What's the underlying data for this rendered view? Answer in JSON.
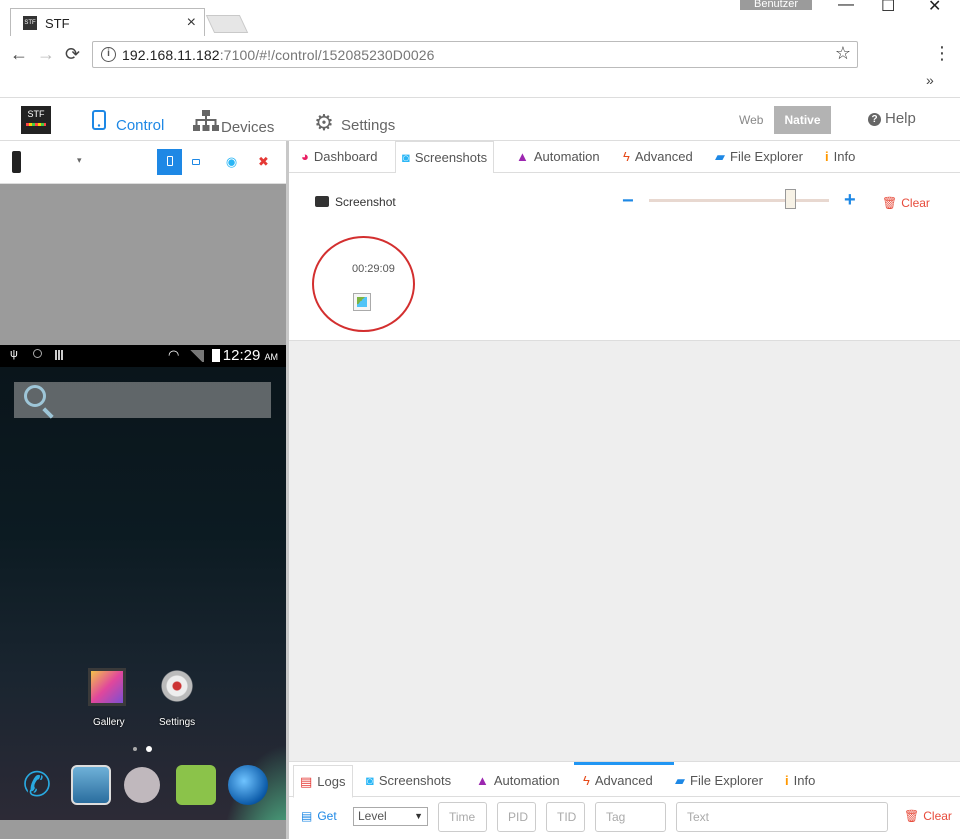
{
  "browser": {
    "tab_title": "STF",
    "tab_close": "×",
    "user_label": "Benutzer",
    "window_minimize": "—",
    "window_restore": "☐",
    "window_close": "✕",
    "nav_back": "←",
    "nav_forward": "→",
    "nav_reload": "⟳",
    "url_host": "192.168.11.182",
    "url_path": ":7100/#!/control/152085230D0026",
    "info_icon": "i",
    "bookmark_star": "☆",
    "menu_dots": "⋮",
    "overflow": "»"
  },
  "stf_nav": {
    "logo": "STF",
    "items": [
      {
        "label": "Control",
        "icon": "phone-icon"
      },
      {
        "label": "Devices",
        "icon": "sitemap-icon"
      },
      {
        "label": "Settings",
        "icon": "gears-icon"
      }
    ],
    "web_label": "Web",
    "native_label": "Native",
    "help_label": "Help"
  },
  "device_bar": {
    "caret": "▾",
    "buttons": [
      "portrait-icon",
      "landscape-icon",
      "eye-icon",
      "close-icon"
    ]
  },
  "phone": {
    "time": "12:29",
    "ampm": "AM",
    "apps": [
      {
        "label": "Gallery"
      },
      {
        "label": "Settings"
      }
    ]
  },
  "top_tabs": [
    {
      "label": "Dashboard",
      "icon": "dashboard-icon",
      "color": "#e91e63"
    },
    {
      "label": "Screenshots",
      "icon": "camera-icon",
      "color": "#29b6f6"
    },
    {
      "label": "Automation",
      "icon": "road-icon",
      "color": "#9c27b0"
    },
    {
      "label": "Advanced",
      "icon": "bolt-icon",
      "color": "#e64a19"
    },
    {
      "label": "File Explorer",
      "icon": "folder-open-icon",
      "color": "#1e88e5"
    },
    {
      "label": "Info",
      "icon": "info-icon",
      "color": "#ff9800"
    }
  ],
  "screenshots": {
    "button_label": "Screenshot",
    "minus": "−",
    "plus": "+",
    "clear_label": "Clear",
    "zoom_fraction": 0.82,
    "items": [
      {
        "time": "00:29:09"
      }
    ]
  },
  "bottom_tabs": [
    {
      "label": "Logs",
      "icon": "list-icon",
      "color": "#e53935"
    },
    {
      "label": "Screenshots",
      "icon": "camera-icon",
      "color": "#29b6f6"
    },
    {
      "label": "Automation",
      "icon": "road-icon",
      "color": "#9c27b0"
    },
    {
      "label": "Advanced",
      "icon": "bolt-icon",
      "color": "#e64a19"
    },
    {
      "label": "File Explorer",
      "icon": "folder-open-icon",
      "color": "#1e88e5"
    },
    {
      "label": "Info",
      "icon": "info-icon",
      "color": "#ff9800"
    }
  ],
  "logs": {
    "get_label": "Get",
    "level_label": "Level",
    "fields": [
      {
        "placeholder": "Time"
      },
      {
        "placeholder": "PID"
      },
      {
        "placeholder": "TID"
      },
      {
        "placeholder": "Tag"
      },
      {
        "placeholder": "Text"
      }
    ],
    "clear_label": "Clear"
  }
}
